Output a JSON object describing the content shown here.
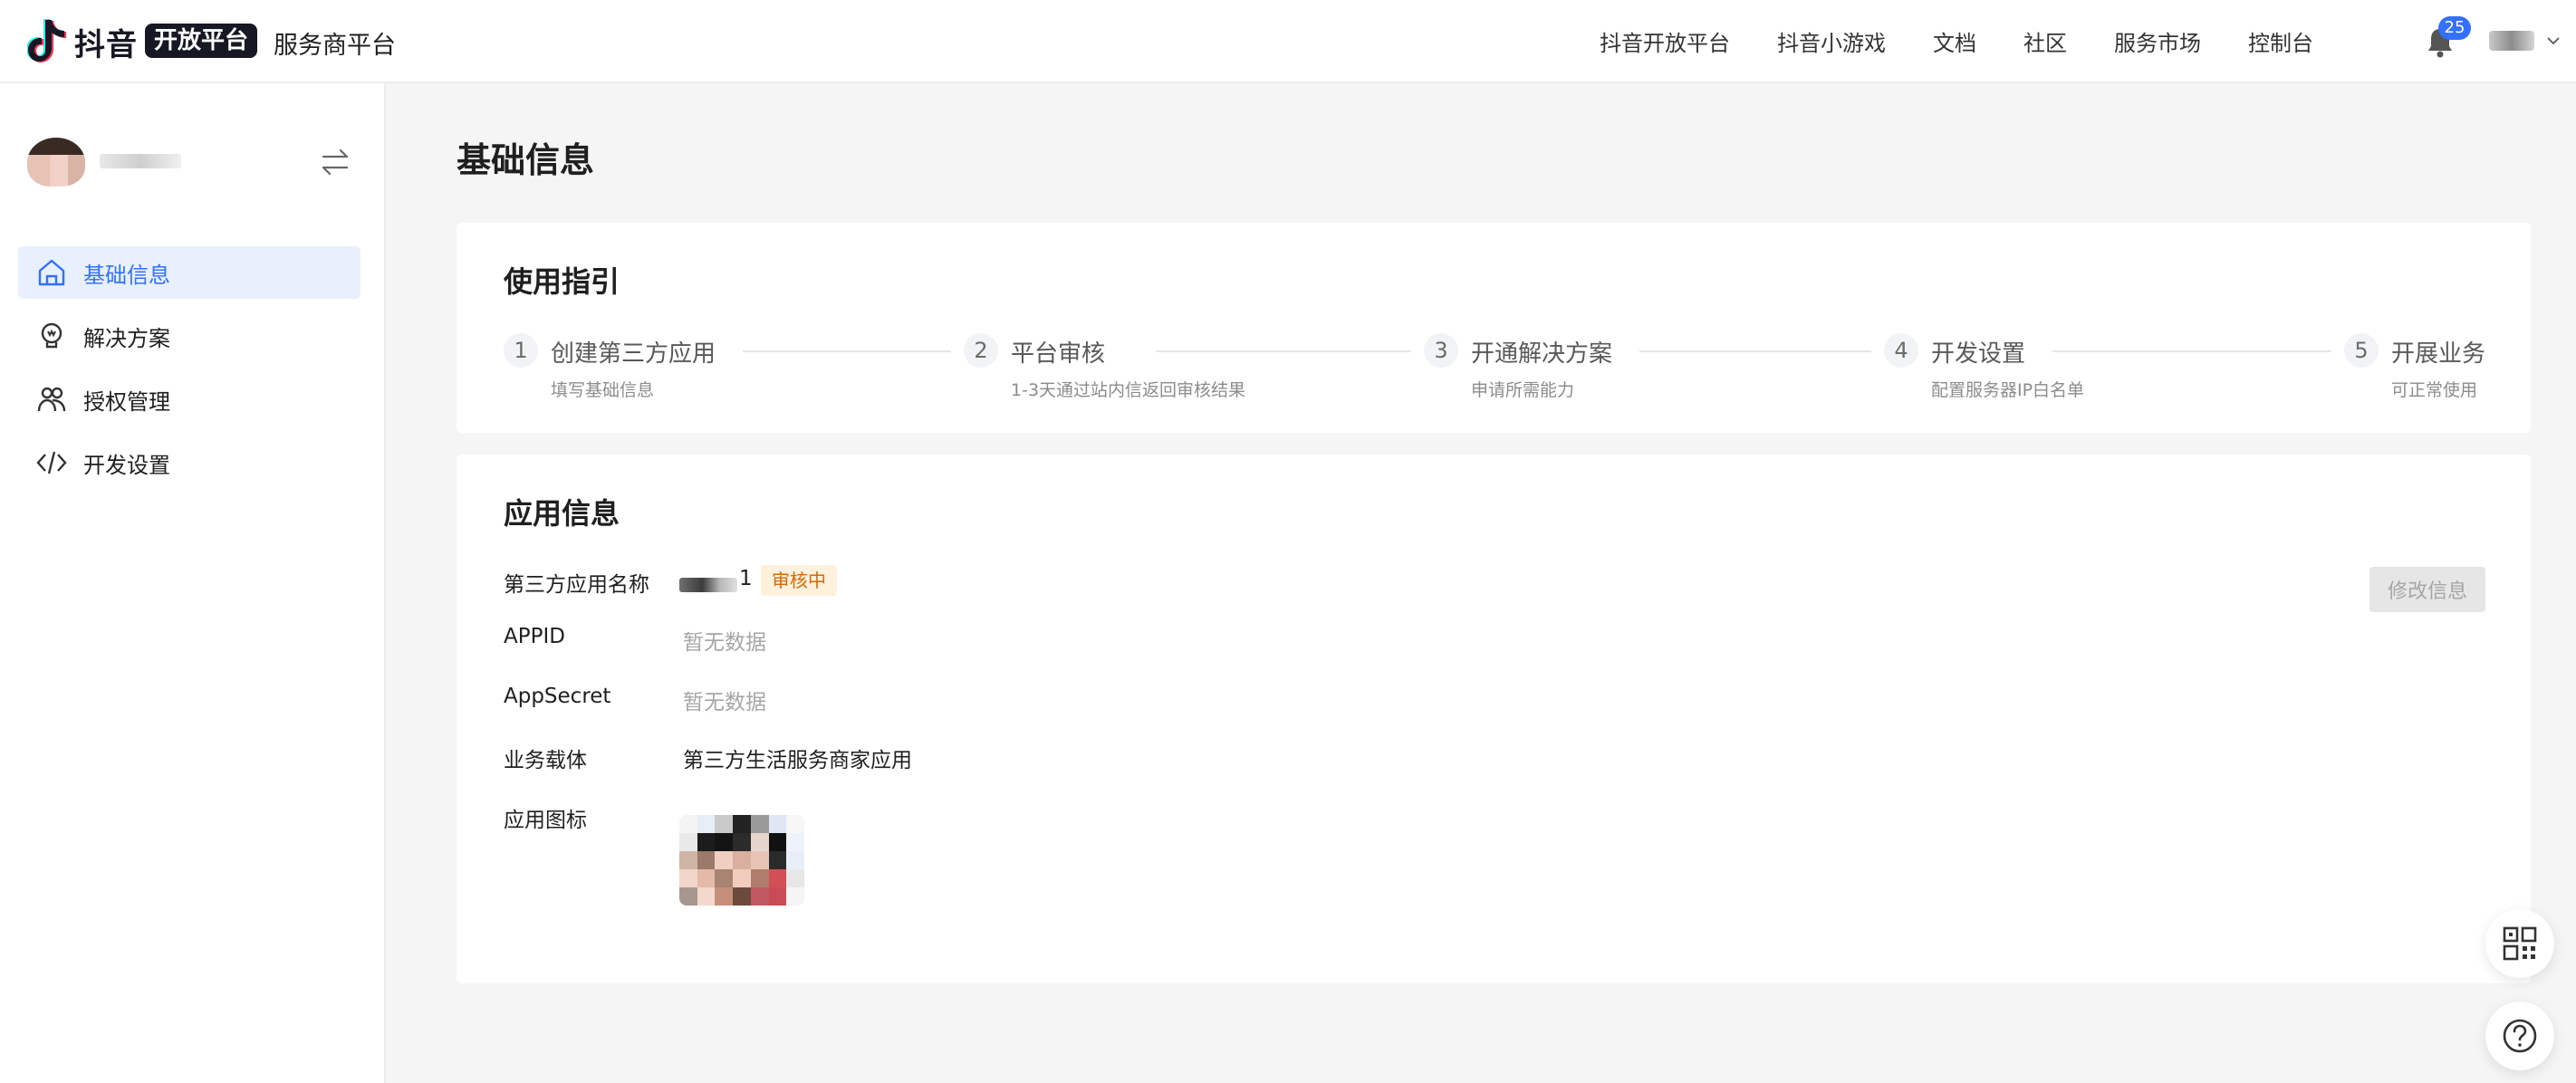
{
  "header": {
    "brand_name": "抖音",
    "brand_tag": "开放平台",
    "brand_sub": "服务商平台",
    "nav": [
      {
        "label": "抖音开放平台"
      },
      {
        "label": "抖音小游戏"
      },
      {
        "label": "文档"
      },
      {
        "label": "社区"
      },
      {
        "label": "服务市场"
      },
      {
        "label": "控制台"
      }
    ],
    "notification_count": "25"
  },
  "sidebar": {
    "menu": [
      {
        "label": "基础信息",
        "icon": "home-icon",
        "active": true
      },
      {
        "label": "解决方案",
        "icon": "lightbulb-icon",
        "active": false
      },
      {
        "label": "授权管理",
        "icon": "users-icon",
        "active": false
      },
      {
        "label": "开发设置",
        "icon": "code-icon",
        "active": false
      }
    ]
  },
  "main": {
    "page_title": "基础信息",
    "guide": {
      "title": "使用指引",
      "steps": [
        {
          "num": "1",
          "title": "创建第三方应用",
          "desc": "填写基础信息"
        },
        {
          "num": "2",
          "title": "平台审核",
          "desc": "1-3天通过站内信返回审核结果"
        },
        {
          "num": "3",
          "title": "开通解决方案",
          "desc": "申请所需能力"
        },
        {
          "num": "4",
          "title": "开发设置",
          "desc": "配置服务器IP白名单"
        },
        {
          "num": "5",
          "title": "开展业务",
          "desc": "可正常使用"
        }
      ]
    },
    "app_info": {
      "title": "应用信息",
      "edit_label": "修改信息",
      "fields": {
        "name_label": "第三方应用名称",
        "name_suffix": "1",
        "status": "审核中",
        "appid_label": "APPID",
        "appid_value": "暂无数据",
        "secret_label": "AppSecret",
        "secret_value": "暂无数据",
        "carrier_label": "业务载体",
        "carrier_value": "第三方生活服务商家应用",
        "icon_label": "应用图标"
      }
    }
  },
  "colors": {
    "accent": "#3370ff",
    "active_bg": "#e8f0fe",
    "status_bg": "#fff1db",
    "status_fg": "#d46b08",
    "page_bg": "#f5f5f5"
  }
}
